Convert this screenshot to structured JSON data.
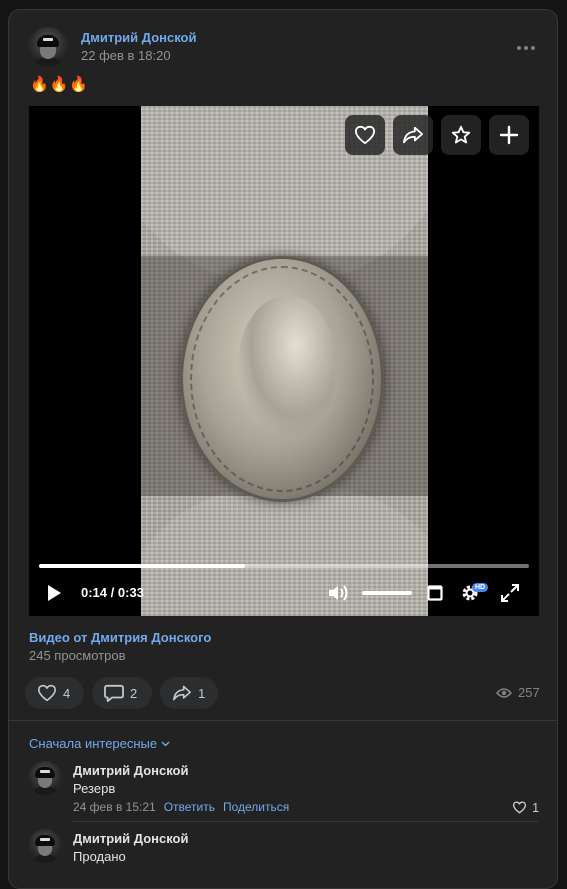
{
  "post": {
    "author": "Дмитрий Донской",
    "date": "22 фев в 18:20",
    "text": "🔥🔥🔥"
  },
  "video": {
    "current_time": "0:14",
    "separator": "/",
    "duration": "0:33",
    "progress": 0.42,
    "volume": 1.0,
    "hd_label": "HD",
    "title": "Видео от Дмитрия Донского",
    "views": "245 просмотров"
  },
  "actions": {
    "likes": "4",
    "comments": "2",
    "shares": "1",
    "views": "257"
  },
  "comments_section": {
    "sort_label": "Сначала интересные",
    "items": [
      {
        "author": "Дмитрий Донской",
        "text": "Резерв",
        "date": "24 фев в 15:21",
        "reply_label": "Ответить",
        "share_label": "Поделиться",
        "likes": "1"
      },
      {
        "author": "Дмитрий Донской",
        "text": "Продано"
      }
    ]
  },
  "colors": {
    "accent": "#71aaeb",
    "background": "#222222",
    "muted": "#939393"
  }
}
